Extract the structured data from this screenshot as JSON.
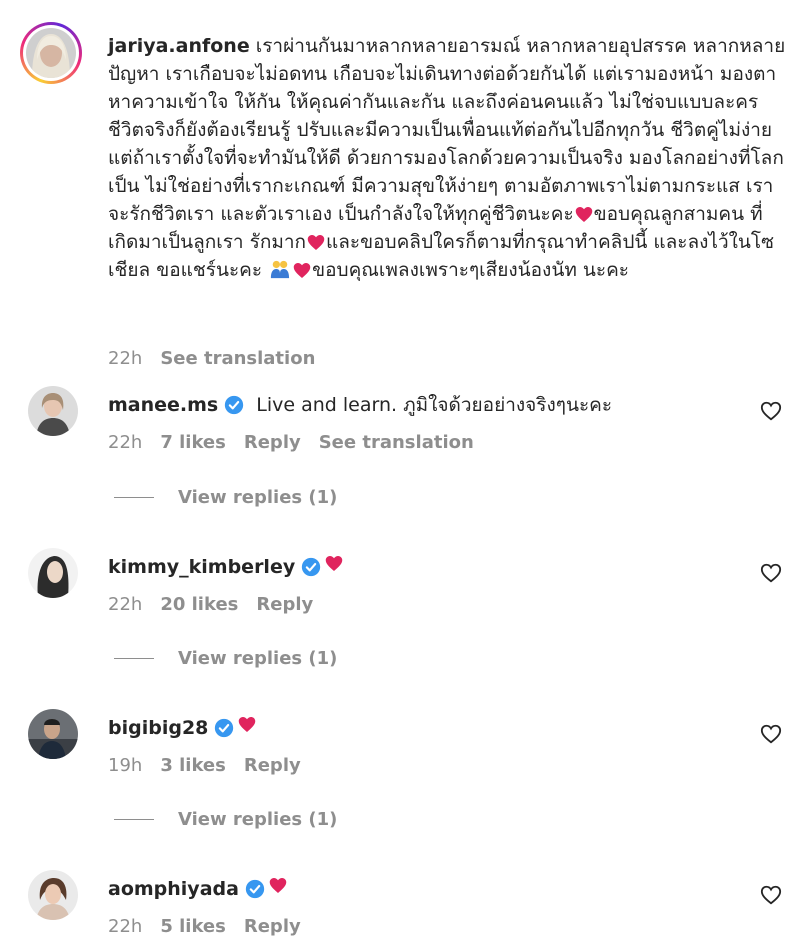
{
  "caption": {
    "username": "jariya.anfone",
    "text_part1": "เราผ่านกันมาหลากหลายอารมณ์ หลากหลายอุปสรรค หลากหลายปัญหา เราเกือบจะไม่อดทน เกือบจะไม่เดินทางต่อด้วยกันได้ แต่เรามองหน้า มองตาหาความเข้าใจ ให้กัน ให้คุณค่ากันและกัน และถึงค่อนคนแล้ว ไม่ใช่จบแบบละคร ชีวิตจริงก็ยังต้องเรียนรู้ ปรับและมีความเป็นเพื่อนแท้ต่อกันไปอีกทุกวัน ชีวิตคู่ไม่ง่าย แต่ถ้าเราตั้งใจที่จะทำมันให้ดี ด้วยการมองโลกด้วยความเป็นจริง มองโลกอย่างที่โลกเป็น ไม่ใช่อย่างที่เรากะเกณฑ์ มีความสุขให้ง่ายๆ ตามอัตภาพเราไม่ตามกระแส เราจะรักชีวิตเรา และตัวเราเอง เป็นกำลังใจให้ทุกคู่ชีวิตนะคะ",
    "text_part2": "ขอบคุณลูกสามคน ที่เกิดมาเป็นลูกเรา รักมาก",
    "text_part3": "และขอบคลิปใครก็ตามที่กรุณาทำคลิปนี้ และลงไว้ในโซเชียล ขอแชร์นะคะ ",
    "text_part4": "ขอบคุณเพลงเพราะๆเสียงน้องนัท นะคะ",
    "time": "22h",
    "see_translation": "See translation"
  },
  "comments": [
    {
      "username": "manee.ms",
      "text": "Live and learn. ภูมิใจด้วยอย่างจริงๆนะคะ",
      "time": "22h",
      "likes": "7 likes",
      "reply": "Reply",
      "see_translation": "See translation",
      "view_replies": "View replies (1)"
    },
    {
      "username": "kimmy_kimberley",
      "text": "",
      "time": "22h",
      "likes": "20 likes",
      "reply": "Reply",
      "view_replies": "View replies (1)"
    },
    {
      "username": "bigibig28",
      "text": "",
      "time": "19h",
      "likes": "3 likes",
      "reply": "Reply",
      "view_replies": "View replies (1)"
    },
    {
      "username": "aomphiyada",
      "text": "",
      "time": "22h",
      "likes": "5 likes",
      "reply": "Reply"
    }
  ],
  "icons": {
    "verified": "verified-badge-icon",
    "heart": "heart-outline-icon",
    "red_heart": "red-heart-emoji-icon",
    "couple": "couple-emoji-icon"
  },
  "colors": {
    "verified_blue": "#3797f0",
    "secondary_text": "#8e8e8e",
    "primary_text": "#262626",
    "emoji_red": "#e0245e"
  }
}
